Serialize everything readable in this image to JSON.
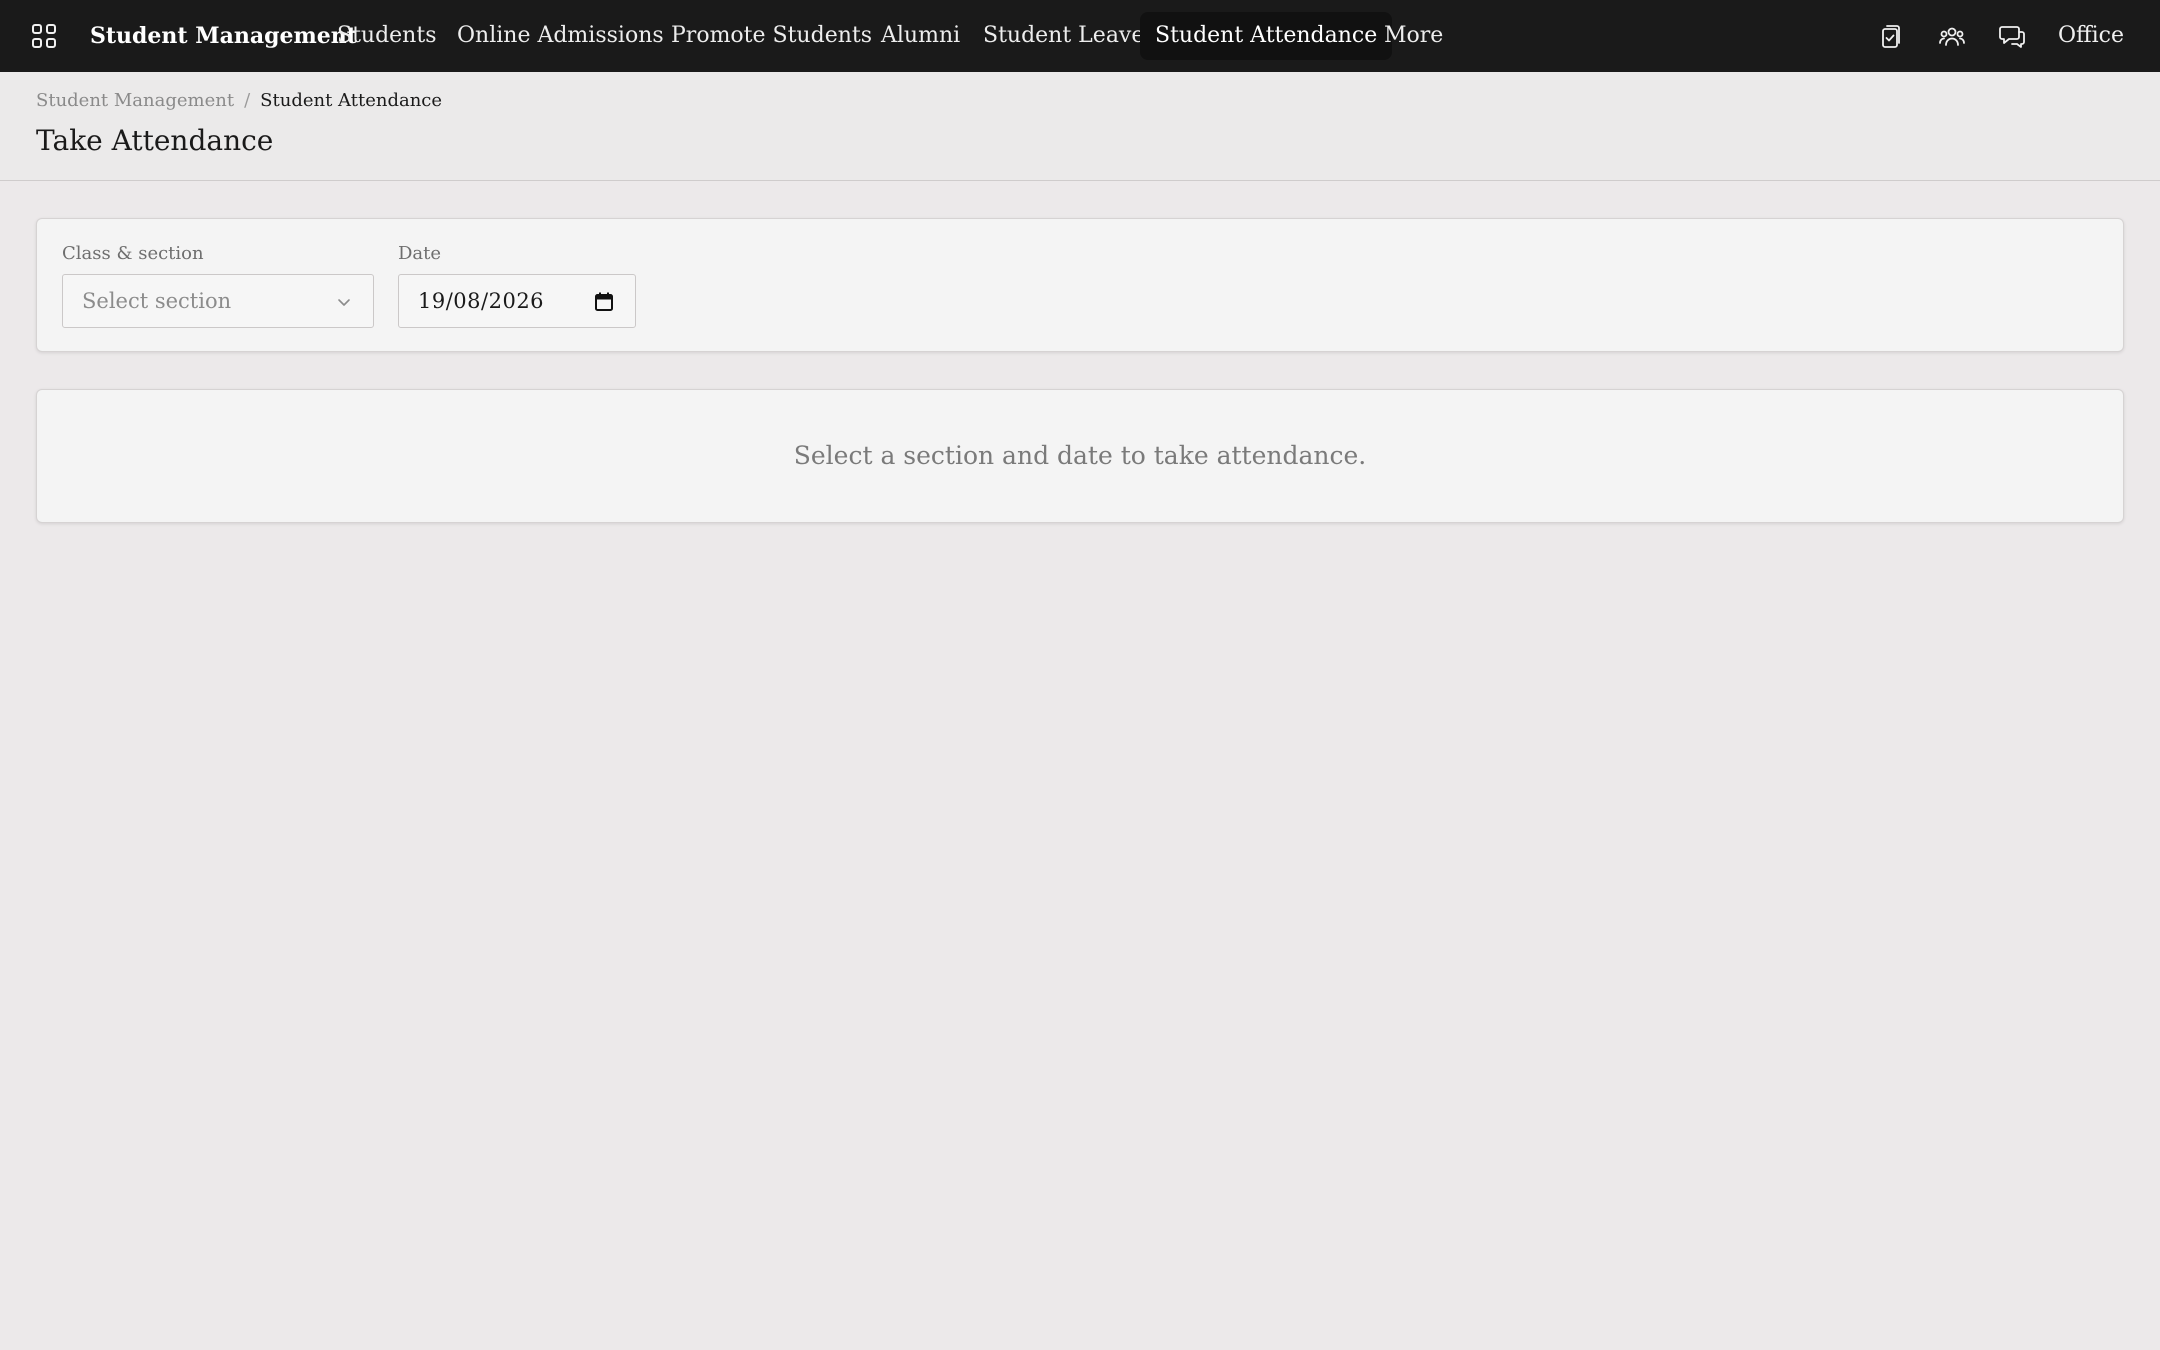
{
  "topbar": {
    "apps_icon": "grid-apps-icon",
    "brand": "Student Management",
    "nav_items": [
      {
        "label": "Students"
      },
      {
        "label": "Online Admissions"
      },
      {
        "label": "Promote Students"
      },
      {
        "label": "Alumni"
      },
      {
        "label": "Student Leave"
      },
      {
        "label": "Student Attendance",
        "active": true
      },
      {
        "label": "More"
      }
    ],
    "icons": [
      "clipboard-check-icon",
      "users-group-icon",
      "chat-bubbles-icon"
    ],
    "office_label": "Office",
    "background_color": "#1a1a1a"
  },
  "breadcrumb": {
    "parent": "Student Management",
    "separator": "/",
    "current": "Student Attendance"
  },
  "page": {
    "title": "Take Attendance"
  },
  "filters": {
    "section_label": "Class & section",
    "section_placeholder": "Select section",
    "date_label": "Date",
    "date_value": "19/08/2026"
  },
  "empty_state": {
    "message": "Select a section and date to take attendance."
  }
}
